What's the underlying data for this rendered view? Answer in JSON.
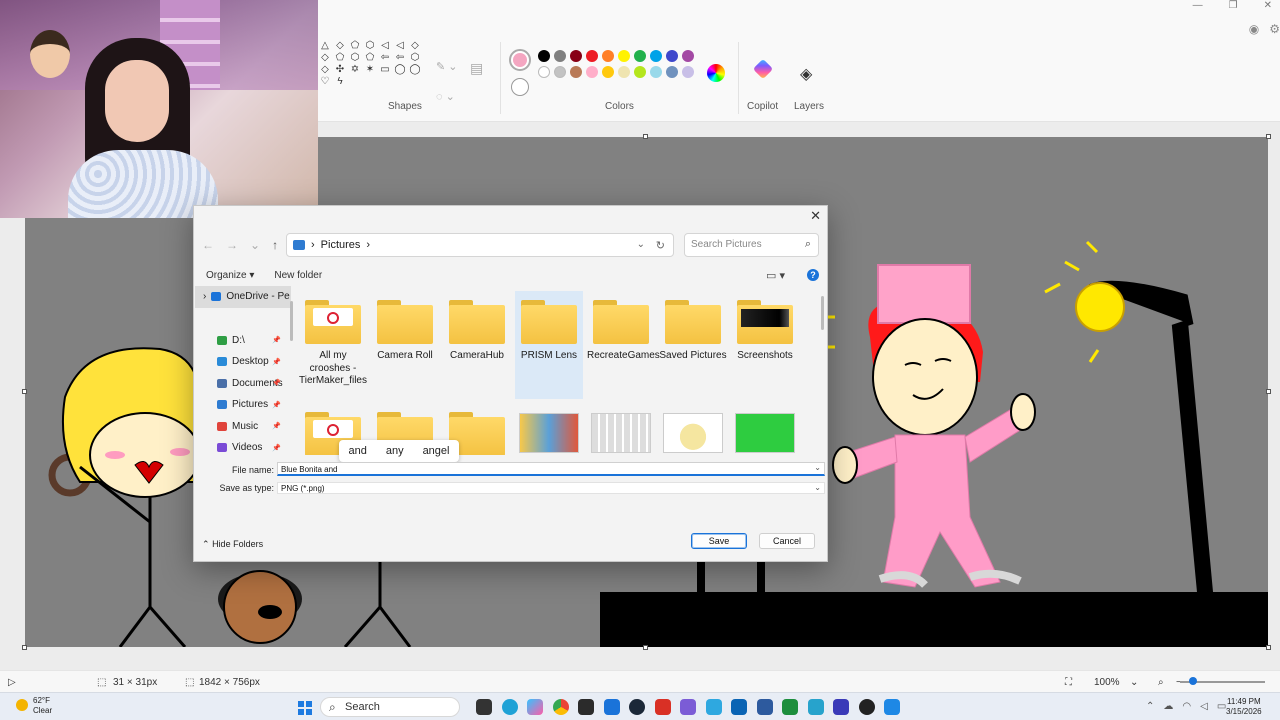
{
  "ribbon": {
    "groups": {
      "shapes": "Shapes",
      "colors": "Colors",
      "copilot": "Copilot",
      "layers": "Layers"
    },
    "current_color": "#f4a6c1",
    "palette": [
      "#000000",
      "#7f7f7f",
      "#880015",
      "#ed1c24",
      "#ff7f27",
      "#fff200",
      "#22b14c",
      "#00a2e8",
      "#3f48cc",
      "#a349a4",
      "#ffffff",
      "#c3c3c3",
      "#b97a57",
      "#ffaec9",
      "#ffc90e",
      "#efe4b0",
      "#b5e61d",
      "#99d9ea",
      "#7092be",
      "#c8bfe7"
    ],
    "icons": {
      "shapes": "shapes-icon",
      "copilot": "copilot-icon",
      "layers": "layers-icon",
      "edit_colors": "rainbow-picker-icon"
    }
  },
  "dialog": {
    "path": "Pictures",
    "search_placeholder": "Search Pictures",
    "organize": "Organize ▾",
    "new_folder": "New folder",
    "nav": [
      {
        "label": "OneDrive - Pe",
        "color": "#1a73d9"
      },
      {
        "label": "D:\\",
        "color": "#2e9e44"
      },
      {
        "label": "Desktop",
        "color": "#2a8bd8"
      },
      {
        "label": "Documents",
        "color": "#4a6fa8"
      },
      {
        "label": "Pictures",
        "color": "#2e7bd1"
      },
      {
        "label": "Music",
        "color": "#e0433b"
      },
      {
        "label": "Videos",
        "color": "#7a4bd6"
      }
    ],
    "folders": [
      {
        "name": "All my crooshes - TierMaker_files",
        "thumb": "doc"
      },
      {
        "name": "Camera Roll",
        "thumb": "plain"
      },
      {
        "name": "CameraHub",
        "thumb": "plain"
      },
      {
        "name": "PRISM Lens",
        "thumb": "plain",
        "selected": true
      },
      {
        "name": "RecreateGames",
        "thumb": "plain"
      },
      {
        "name": "Saved Pictures",
        "thumb": "plain"
      },
      {
        "name": "Screenshots",
        "thumb": "dark"
      }
    ],
    "autocomplete": [
      "and",
      "any",
      "angel"
    ],
    "file_name_label": "File name:",
    "file_name_value": "Blue Bonita and",
    "save_type_label": "Save as type:",
    "save_type_value": "PNG (*.png)",
    "hide_folders": "Hide Folders",
    "save": "Save",
    "cancel": "Cancel"
  },
  "statusbar": {
    "selection_size": "31 × 31px",
    "image_size": "1842 × 756px",
    "zoom": "100%"
  },
  "taskbar": {
    "weather_temp": "62°F",
    "weather_desc": "Clear",
    "search": "Search",
    "time": "11:49 PM",
    "date": "3/15/2026"
  }
}
